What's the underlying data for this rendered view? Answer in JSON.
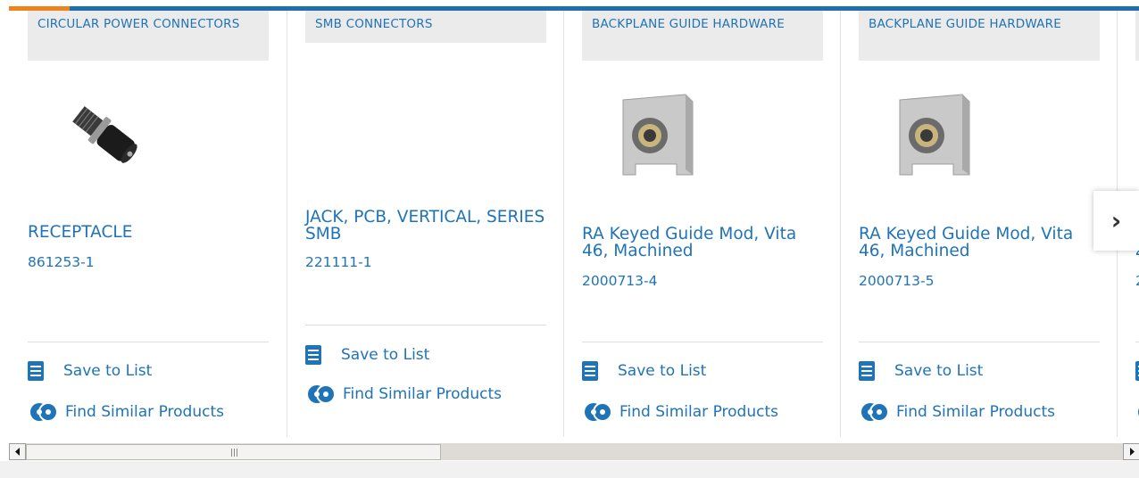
{
  "carousel": {
    "cards": [
      {
        "category": "CIRCULAR POWER CONNECTORS",
        "name": "RECEPTACLE",
        "part_number": "861253-1",
        "product_icon": "circular-connector-image",
        "save_label": "Save to List",
        "similar_label": "Find Similar Products"
      },
      {
        "category": "SMB CONNECTORS",
        "name": "JACK, PCB, VERTICAL, SERIES SMB",
        "part_number": "221111-1",
        "product_icon": "",
        "save_label": "Save to List",
        "similar_label": "Find Similar Products"
      },
      {
        "category": "BACKPLANE GUIDE HARDWARE",
        "name": "RA Keyed Guide Mod, Vita 46, Machined",
        "part_number": "2000713-4",
        "product_icon": "guide-module-image",
        "save_label": "Save to List",
        "similar_label": "Find Similar Products"
      },
      {
        "category": "BACKPLANE GUIDE HARDWARE",
        "name": "RA Keyed Guide Mod, Vita 46, Machined",
        "part_number": "2000713-5",
        "product_icon": "guide-module-image",
        "save_label": "Save to List",
        "similar_label": "Find Similar Products"
      },
      {
        "category": "",
        "name": "4",
        "part_number": "2",
        "product_icon": "",
        "save_label": "",
        "similar_label": ""
      }
    ],
    "next_icon": "chevron-right-icon"
  },
  "scrollbar": {
    "left_icon": "arrow-left-icon",
    "right_icon": "arrow-right-icon"
  },
  "colors": {
    "link": "#1f73b7",
    "accent": "#f0821e",
    "bar": "#1f6fad",
    "category_bg": "#ebebeb"
  }
}
